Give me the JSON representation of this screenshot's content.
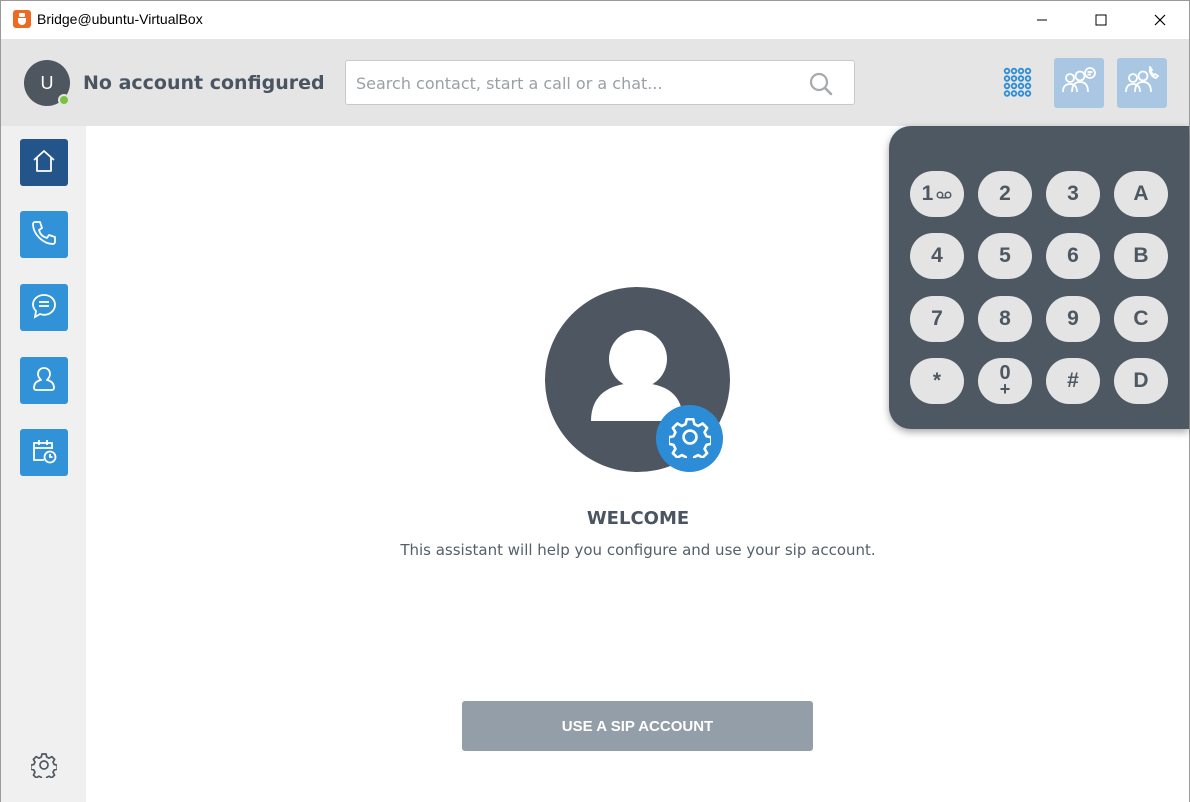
{
  "window": {
    "title": "Bridge@ubuntu-VirtualBox",
    "icon": "app-logo-icon",
    "controls": [
      "minimize-icon",
      "maximize-icon",
      "close-icon"
    ]
  },
  "header": {
    "avatar_initial": "U",
    "account_status": "No account configured",
    "search": {
      "placeholder": "Search contact, start a call or a chat...",
      "value": ""
    },
    "buttons": [
      "dialpad-toggle-icon",
      "conference-chat-icon",
      "conference-call-icon"
    ]
  },
  "sidebar": {
    "items": [
      {
        "name": "home",
        "icon": "home-icon",
        "active": true
      },
      {
        "name": "calls",
        "icon": "phone-icon",
        "active": false
      },
      {
        "name": "chats",
        "icon": "chat-icon",
        "active": false
      },
      {
        "name": "contacts",
        "icon": "contact-icon",
        "active": false
      },
      {
        "name": "meetings",
        "icon": "calendar-clock-icon",
        "active": false
      }
    ],
    "settings_icon": "gear-icon"
  },
  "main": {
    "welcome_title": "WELCOME",
    "welcome_text": "This assistant will help you configure and use your sip account.",
    "sip_button_label": "USE A SIP ACCOUNT"
  },
  "dialpad": {
    "keys": [
      "1",
      "2",
      "3",
      "A",
      "4",
      "5",
      "6",
      "B",
      "7",
      "8",
      "9",
      "C",
      "*",
      "0",
      "#",
      "D"
    ],
    "zero_sub": "+"
  },
  "colors": {
    "accent": "#3292d8",
    "active_nav": "#23558a",
    "dialpad_bg": "#4e5862",
    "presence": "#7ac143",
    "button_disabled": "#939ea9"
  }
}
